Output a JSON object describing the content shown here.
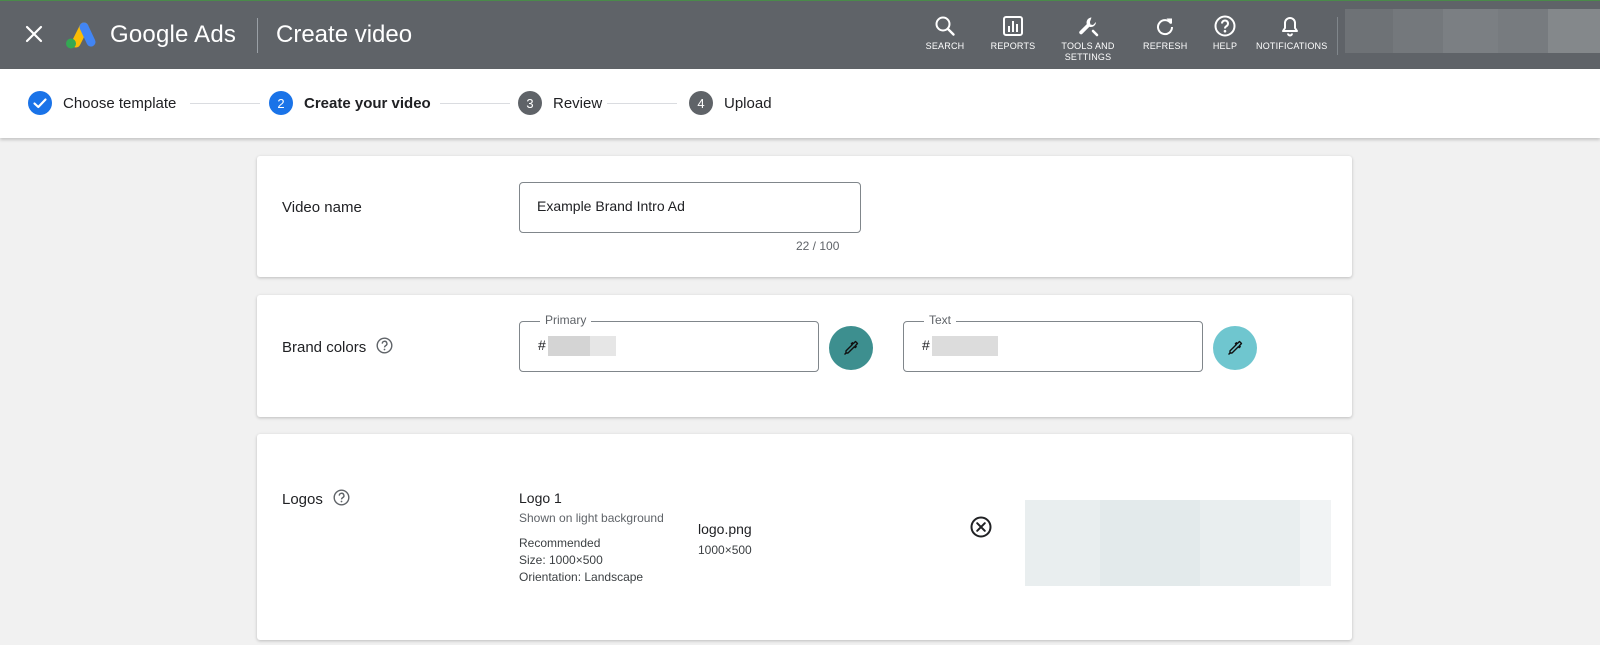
{
  "header": {
    "brand_google": "Google",
    "brand_ads": "Ads",
    "page_title": "Create video",
    "tools": [
      {
        "label": "SEARCH",
        "icon": "search-icon"
      },
      {
        "label": "REPORTS",
        "icon": "reports-icon"
      },
      {
        "label": "TOOLS AND",
        "label2": "SETTINGS",
        "icon": "wrench-icon"
      },
      {
        "label": "REFRESH",
        "icon": "refresh-icon"
      },
      {
        "label": "HELP",
        "icon": "help-icon"
      },
      {
        "label": "NOTIFICATIONS",
        "icon": "bell-icon"
      }
    ],
    "colors": {
      "bar": "#5f6368"
    }
  },
  "stepper": {
    "steps": [
      {
        "number": "",
        "label": "Choose template",
        "state": "complete"
      },
      {
        "number": "2",
        "label": "Create your video",
        "state": "current"
      },
      {
        "number": "3",
        "label": "Review",
        "state": "upcoming"
      },
      {
        "number": "4",
        "label": "Upload",
        "state": "upcoming"
      }
    ],
    "colors": {
      "active": "#1a73e8",
      "upcoming": "#5f6368"
    }
  },
  "video_name": {
    "label": "Video name",
    "value": "Example Brand Intro Ad",
    "counter": "22 / 100"
  },
  "brand_colors": {
    "label": "Brand colors",
    "primary": {
      "legend": "Primary",
      "prefix": "#",
      "swatch": "#3d8f8f"
    },
    "text": {
      "legend": "Text",
      "prefix": "#",
      "swatch": "#6fc6cf"
    }
  },
  "logos": {
    "label": "Logos",
    "logo_title": "Logo 1",
    "logo_subtitle": "Shown on light background",
    "recommended": "Recommended",
    "size": "Size: 1000×500",
    "orientation": "Orientation: Landscape",
    "file_name": "logo.png",
    "file_dims": "1000×500"
  }
}
